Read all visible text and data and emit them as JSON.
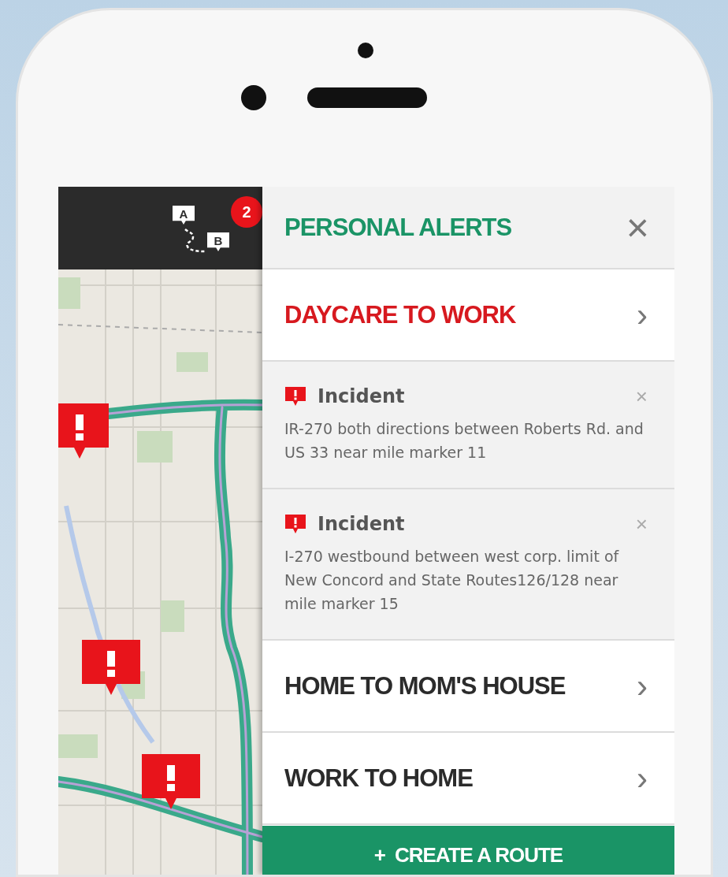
{
  "map_header": {
    "route_icon": {
      "start": "A",
      "end": "B"
    },
    "badge": "2"
  },
  "panel": {
    "title": "PERSONAL ALERTS",
    "close": "×"
  },
  "items": [
    {
      "kind": "route",
      "title": "DAYCARE TO WORK",
      "alert": true,
      "chevron": "›"
    },
    {
      "kind": "incident",
      "title": "Incident",
      "text": "IR-270 both directions between Roberts Rd. and US 33 near mile marker 11",
      "close": "×"
    },
    {
      "kind": "incident",
      "title": "Incident",
      "text": "I-270 westbound between west corp. limit of New Concord and State Routes126/128 near mile marker 15",
      "close": "×"
    },
    {
      "kind": "route",
      "title": "HOME TO MOM'S HOUSE",
      "alert": false,
      "chevron": "›"
    },
    {
      "kind": "route",
      "title": "WORK TO HOME",
      "alert": false,
      "chevron": "›"
    }
  ],
  "create_button": {
    "icon": "+",
    "label": "CREATE A ROUTE"
  }
}
